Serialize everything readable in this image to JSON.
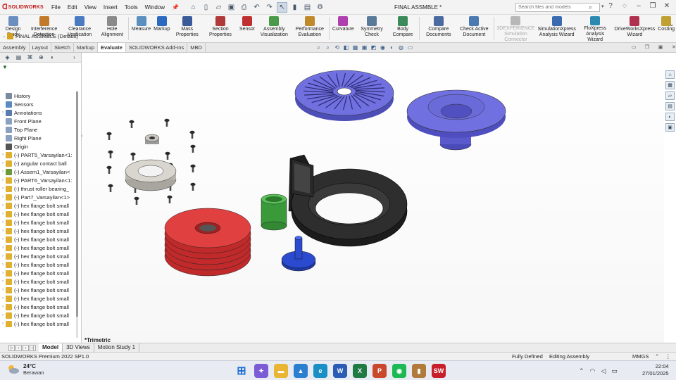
{
  "app": {
    "name": "SOLIDWORKS",
    "document_title": "FINAL ASSMBLE *",
    "menu": [
      "File",
      "Edit",
      "View",
      "Insert",
      "Tools",
      "Window"
    ]
  },
  "search": {
    "placeholder": "Search files and models"
  },
  "ribbon": {
    "buttons": [
      {
        "label": "Design Study",
        "icon": "design-study-icon",
        "color": "#6a8fbf"
      },
      {
        "label": "Interference Detection",
        "icon": "interference-icon",
        "color": "#c07a2a"
      },
      {
        "label": "Clearance Verification",
        "icon": "clearance-icon",
        "color": "#4a7ac0"
      },
      {
        "label": "Hole Alignment",
        "icon": "hole-alignment-icon",
        "color": "#8a8a8a"
      },
      {
        "label": "Measure",
        "icon": "measure-icon",
        "color": "#5a8fc0"
      },
      {
        "label": "Markup",
        "icon": "markup-icon",
        "color": "#2a6ac0"
      },
      {
        "label": "Mass Properties",
        "icon": "mass-properties-icon",
        "color": "#3a5a9a"
      },
      {
        "label": "Section Properties",
        "icon": "section-properties-icon",
        "color": "#b03a3a"
      },
      {
        "label": "Sensor",
        "icon": "sensor-icon",
        "color": "#c03030"
      },
      {
        "label": "Assembly Visualization",
        "icon": "assembly-visualization-icon",
        "color": "#4a9a4a"
      },
      {
        "label": "Performance Evaluation",
        "icon": "performance-icon",
        "color": "#c08a2a"
      },
      {
        "label": "Curvature",
        "icon": "curvature-icon",
        "color": "#b040b0"
      },
      {
        "label": "Symmetry Check",
        "icon": "symmetry-icon",
        "color": "#5a7a9a"
      },
      {
        "label": "Body Compare",
        "icon": "body-compare-icon",
        "color": "#3a8a5a"
      },
      {
        "label": "Compare Documents",
        "icon": "compare-docs-icon",
        "color": "#4a6aa0"
      },
      {
        "label": "Check Active Document",
        "icon": "check-doc-icon",
        "color": "#4a7ab0"
      },
      {
        "label": "3DEXPERIENCE Simulation Connector",
        "icon": "simulation-connector-icon",
        "color": "#b8b8b8",
        "disabled": true
      },
      {
        "label": "SimulationXpress Analysis Wizard",
        "icon": "simulationxpress-icon",
        "color": "#3a6ab0"
      },
      {
        "label": "FloXpress Analysis Wizard",
        "icon": "floxpress-icon",
        "color": "#2a8ab0"
      },
      {
        "label": "DriveWorksXpress Wizard",
        "icon": "driveworks-icon",
        "color": "#b03050"
      },
      {
        "label": "Costing",
        "icon": "costing-icon",
        "color": "#c0a030"
      }
    ]
  },
  "command_tabs": [
    "Assembly",
    "Layout",
    "Sketch",
    "Markup",
    "Evaluate",
    "SOLIDWORKS Add-Ins",
    "MBD"
  ],
  "active_command_tab": "Evaluate",
  "tree": {
    "root": "FINAL ASSMBLE (Default) <",
    "items": [
      {
        "label": "History",
        "icon": "history-icon",
        "expand": ""
      },
      {
        "label": "Sensors",
        "icon": "sensors-icon",
        "expand": ""
      },
      {
        "label": "Annotations",
        "icon": "annotations-icon",
        "expand": "›"
      },
      {
        "label": "Front Plane",
        "icon": "plane-icon",
        "expand": ""
      },
      {
        "label": "Top Plane",
        "icon": "plane-icon",
        "expand": ""
      },
      {
        "label": "Right Plane",
        "icon": "plane-icon",
        "expand": ""
      },
      {
        "label": "Origin",
        "icon": "origin-icon",
        "expand": ""
      },
      {
        "label": "(-) PART5_Varsayilan<1:",
        "icon": "part-icon",
        "expand": "›"
      },
      {
        "label": "(-) angular contact ball",
        "icon": "part-icon",
        "expand": "›"
      },
      {
        "label": "(-) Assem1_Varsayilan<",
        "icon": "assembly-icon",
        "expand": "›"
      },
      {
        "label": "(-) PART6_Varsayilan<1:",
        "icon": "part-icon",
        "expand": "›"
      },
      {
        "label": "(-) thrust roller bearing_",
        "icon": "part-icon",
        "expand": "›"
      },
      {
        "label": "(-) Part7_Varsayilan<1>",
        "icon": "part-icon",
        "expand": "›"
      },
      {
        "label": "(-) hex flange bolt small",
        "icon": "part-icon",
        "expand": "›"
      },
      {
        "label": "(-) hex flange bolt small",
        "icon": "part-icon",
        "expand": "›"
      },
      {
        "label": "(-) hex flange bolt small",
        "icon": "part-icon",
        "expand": "›"
      },
      {
        "label": "(-) hex flange bolt small",
        "icon": "part-icon",
        "expand": "›"
      },
      {
        "label": "(-) hex flange bolt small",
        "icon": "part-icon",
        "expand": "›"
      },
      {
        "label": "(-) hex flange bolt small",
        "icon": "part-icon",
        "expand": "›"
      },
      {
        "label": "(-) hex flange bolt small",
        "icon": "part-icon",
        "expand": "›"
      },
      {
        "label": "(-) hex flange bolt small",
        "icon": "part-icon",
        "expand": "›"
      },
      {
        "label": "(-) hex flange bolt small",
        "icon": "part-icon",
        "expand": "›"
      },
      {
        "label": "(-) hex flange bolt small",
        "icon": "part-icon",
        "expand": "›"
      },
      {
        "label": "(-) hex flange bolt small",
        "icon": "part-icon",
        "expand": "›"
      },
      {
        "label": "(-) hex flange bolt small",
        "icon": "part-icon",
        "expand": "›"
      },
      {
        "label": "(-) hex flange bolt small",
        "icon": "part-icon",
        "expand": "›"
      },
      {
        "label": "(-) hex flange bolt small",
        "icon": "part-icon",
        "expand": "›"
      },
      {
        "label": "(-) hex flange bolt small",
        "icon": "part-icon",
        "expand": "›"
      }
    ]
  },
  "viewport": {
    "view_orientation": "*Trimetric",
    "axis_x": "X",
    "axis_y": "Y"
  },
  "bottom_tabs": [
    "Model",
    "3D Views",
    "Motion Study 1"
  ],
  "active_bottom_tab": "Model",
  "status": {
    "product": "SOLIDWORKS Premium 2022 SP1.0",
    "definition": "Fully Defined",
    "mode": "Editing Assembly",
    "units": "MMGS"
  },
  "taskbar": {
    "temperature": "24°C",
    "weather": "Berawan",
    "time": "22:04",
    "date": "27/01/2025",
    "apps": [
      {
        "name": "start-icon",
        "color": "#1f6fd6",
        "glyph": "⊞"
      },
      {
        "name": "copilot-icon",
        "color": "#7b5cd6",
        "glyph": "✦"
      },
      {
        "name": "file-explorer-icon",
        "color": "#e8b534",
        "glyph": "▬"
      },
      {
        "name": "photos-icon",
        "color": "#2b7fd0",
        "glyph": "▲"
      },
      {
        "name": "edge-icon",
        "color": "#1a8fc6",
        "glyph": "e"
      },
      {
        "name": "word-icon",
        "color": "#2b5bb5",
        "glyph": "W"
      },
      {
        "name": "excel-icon",
        "color": "#1f7a44",
        "glyph": "X"
      },
      {
        "name": "powerpoint-icon",
        "color": "#c9472a",
        "glyph": "P"
      },
      {
        "name": "spotify-icon",
        "color": "#1db954",
        "glyph": "◉"
      },
      {
        "name": "app-icon",
        "color": "#b07a3a",
        "glyph": "▮"
      },
      {
        "name": "solidworks-taskbar-icon",
        "color": "#c8202a",
        "glyph": "SW"
      }
    ]
  },
  "colors": {
    "impeller": "#6a6ad8",
    "cover": "#6a6ad8",
    "casing": "#2a2a2a",
    "disc_stack": "#d83a3a",
    "sleeve": "#4aa84a",
    "shaft": "#2a4ad0",
    "bolts": "#3a3a3a",
    "bearing": "#c9c6bf"
  }
}
